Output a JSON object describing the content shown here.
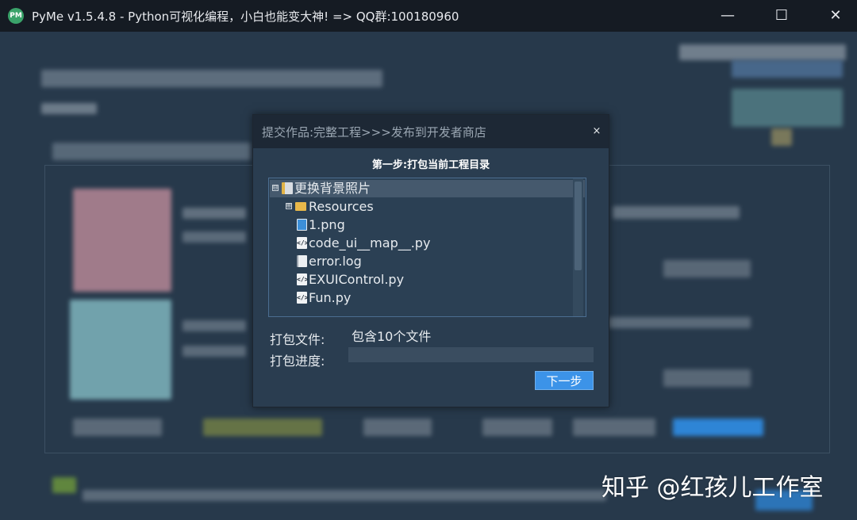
{
  "window": {
    "icon_label": "PM",
    "title": "PyMe v1.5.4.8 - Python可视化编程，小白也能变大神!   => QQ群:100180960",
    "minimize_glyph": "—",
    "maximize_glyph": "☐",
    "close_glyph": "✕"
  },
  "dialog": {
    "title": "提交作品:完整工程>>>发布到开发者商店",
    "close_glyph": "×",
    "step_title": "第一步:打包当前工程目录",
    "tree": [
      {
        "label": "更换背景照片",
        "icon": "project-root-icon",
        "expander": "⊟",
        "selected": true
      },
      {
        "label": "Resources",
        "icon": "folder-icon",
        "expander": "⊞",
        "selected": false
      },
      {
        "label": "1.png",
        "icon": "image-file-icon",
        "selected": false
      },
      {
        "label": "code_ui__map__.py",
        "icon": "python-file-icon",
        "selected": false
      },
      {
        "label": "error.log",
        "icon": "text-file-icon",
        "selected": false
      },
      {
        "label": "EXUIControl.py",
        "icon": "python-file-icon",
        "selected": false
      },
      {
        "label": "Fun.py",
        "icon": "python-file-icon",
        "selected": false
      }
    ],
    "pack_files_label": "打包文件:",
    "pack_files_value": "包含10个文件",
    "pack_progress_label": "打包进度:",
    "pack_progress": 0,
    "next_button": "下一步"
  },
  "watermark": {
    "text": "知乎 @红孩儿工作室"
  },
  "colors": {
    "accent": "#3c93e8",
    "titlebar": "#151b23",
    "background": "#27394b"
  }
}
